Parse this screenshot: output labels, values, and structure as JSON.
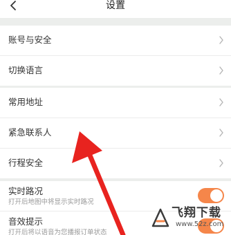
{
  "nav": {
    "title": "设置",
    "back_icon": "chevron-left-icon"
  },
  "groups": [
    {
      "items": [
        {
          "label": "账号与安全"
        },
        {
          "label": "切换语言"
        }
      ]
    },
    {
      "items": [
        {
          "label": "常用地址"
        },
        {
          "label": "紧急联系人"
        },
        {
          "label": "行程安全"
        }
      ]
    },
    {
      "items": [
        {
          "label": "实时路况",
          "subtitle": "打开后地图中将显示实时路况",
          "toggle_on": true
        },
        {
          "label": "音效提示",
          "subtitle": "打开后将以语音为您播报订单状态",
          "toggle_on": true
        }
      ]
    }
  ],
  "colors": {
    "toggle_on": "#f5864a",
    "annotation_arrow": "#e8231f"
  },
  "watermark": {
    "title": "飞翔下载",
    "url": "www.52z.com"
  }
}
